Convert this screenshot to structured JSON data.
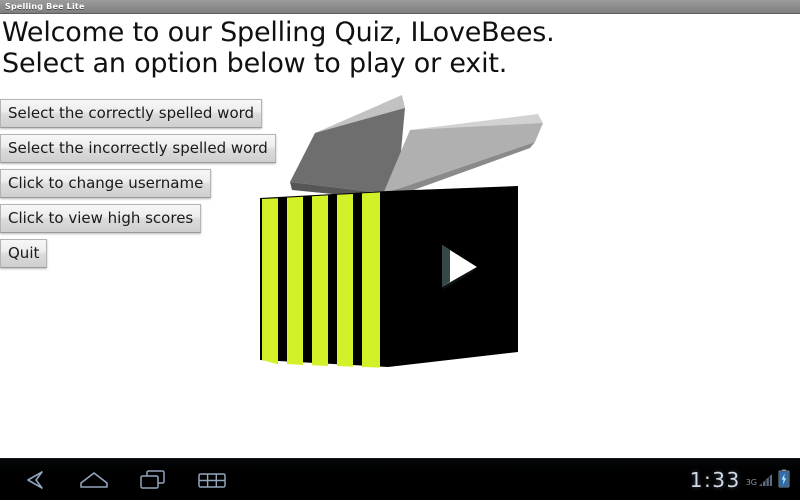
{
  "window": {
    "title": "Spelling Bee Lite"
  },
  "app": {
    "headline_line1": "Welcome to our Spelling Quiz, ILoveBees.",
    "headline_line2": "Select an option below to play or exit.",
    "menu_buttons": [
      {
        "label": "Select the correctly spelled word"
      },
      {
        "label": "Select the incorrectly spelled word"
      },
      {
        "label": "Click to change username"
      },
      {
        "label": "Click to view high scores"
      },
      {
        "label": "Quit"
      }
    ],
    "graphic": {
      "name": "bee-cube-3d",
      "stripe_yellow": "#d4f028",
      "body_black": "#000000",
      "wing_left_color": "#6e6e6e",
      "wing_right_color": "#b0b0b0",
      "play_arrow_color": "#ffffff"
    }
  },
  "system_bar": {
    "nav": [
      {
        "name": "back-icon",
        "label": "Back"
      },
      {
        "name": "home-icon",
        "label": "Home"
      },
      {
        "name": "recents-icon",
        "label": "Recent apps"
      },
      {
        "name": "apps-grid-icon",
        "label": "Apps"
      }
    ],
    "clock": "1:33",
    "signal_label": "3G",
    "battery_state": "charging"
  },
  "colors": {
    "background": "#ffffff",
    "titlebar": "#8e8e8e",
    "text": "#101010",
    "button_face": "#ededed",
    "sysbar": "#000000"
  }
}
